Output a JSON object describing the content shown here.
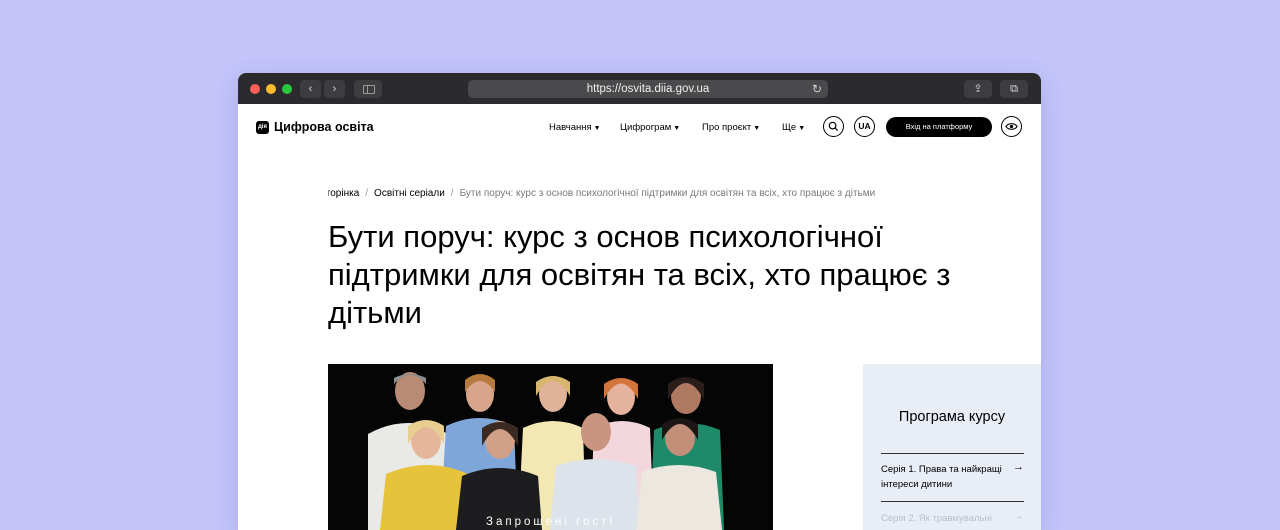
{
  "browser": {
    "url": "https://osvita.diia.gov.ua",
    "back_icon": "‹",
    "forward_icon": "›",
    "reload_icon": "↻",
    "share_icon": "⇪",
    "tabs_icon": "⧉"
  },
  "header": {
    "logo_mark": "дія",
    "logo_text": "Цифрова освіта",
    "menu": [
      {
        "label": "Навчання"
      },
      {
        "label": "Цифрограм"
      },
      {
        "label": "Про проєкт"
      },
      {
        "label": "Ще"
      }
    ],
    "lang": "UA",
    "login_label": "Вхід на платформу"
  },
  "breadcrumb": {
    "home": "Головна сторінка",
    "section": "Освітні серіали",
    "current": "Бути поруч: курс з основ психологічної підтримки для освітян та всіх, хто працює з дітьми"
  },
  "page_title": "Бути поруч: курс з основ психологічної підтримки для освітян та всіх, хто працює з дітьми",
  "video": {
    "caption": "Запрошені гості"
  },
  "program": {
    "title": "Програма курсу",
    "items": [
      {
        "label": "Серія 1. Права та найкращі інтереси дитини"
      },
      {
        "label": "Серія 2. Як травмувальні"
      }
    ]
  },
  "colors": {
    "background": "#c4c4fb",
    "chrome": "#2b2b2d",
    "panel": "#e8edf6",
    "accent": "#000000"
  }
}
